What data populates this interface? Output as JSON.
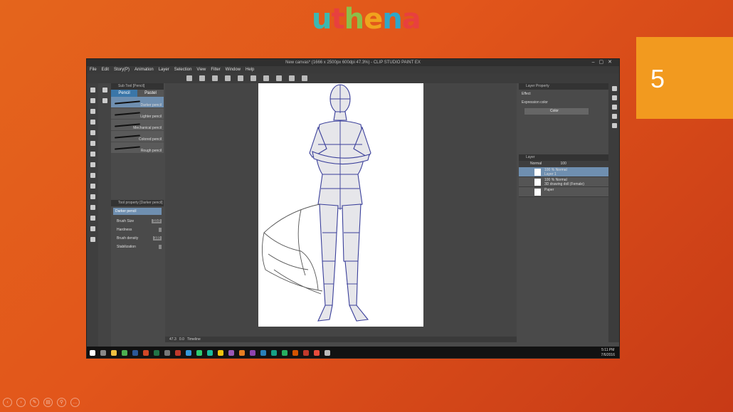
{
  "logo": {
    "p1": "u",
    "p2": "t",
    "p3": "h",
    "p4": "e",
    "p5": "n",
    "p6": "a"
  },
  "slide_number": "5",
  "app": {
    "title": "New canvas* (1666 x 2500px 600dpi 47.3%) - CLIP STUDIO PAINT EX",
    "menu": [
      "File",
      "Edit",
      "Story(P)",
      "Animation",
      "Layer",
      "Selection",
      "View",
      "Filter",
      "Window",
      "Help"
    ],
    "subtool_panel_title": "Sub Tool [Pencil]",
    "brush_tabs": [
      "Pencil",
      "Pastel"
    ],
    "brushes": [
      "Darker pencil",
      "Lighter pencil",
      "Mechanical pencil",
      "Colored pencil",
      "Rough pencil"
    ],
    "tool_property_title": "Tool property [Darker pencil]",
    "tool_property_name": "Darker pencil",
    "props": [
      {
        "label": "Brush Size",
        "value": "10.0"
      },
      {
        "label": "Hardness",
        "value": ""
      },
      {
        "label": "Brush density",
        "value": "100"
      },
      {
        "label": "Stabilization",
        "value": ""
      }
    ],
    "status_zoom": "47.3",
    "status_rotate": "0.0",
    "layer_property_title": "Layer Property",
    "effect_label": "Effect",
    "expression_label": "Expression color",
    "expression_value": "Color",
    "layer_panel_title": "Layer",
    "blend_mode": "Normal",
    "opacity": "100",
    "layers": [
      {
        "line1": "100 % Normal",
        "line2": "Layer 1"
      },
      {
        "line1": "100 % Normal",
        "line2": "3D drawing doll (Female)"
      },
      {
        "line1": "",
        "line2": "Paper"
      }
    ],
    "timeline_tab": "Timeline",
    "clock_time": "5:11 PM",
    "clock_date": "7/6/2016"
  },
  "colors": {
    "accent": "#f29a1f",
    "selection": "#6f8fb0"
  }
}
